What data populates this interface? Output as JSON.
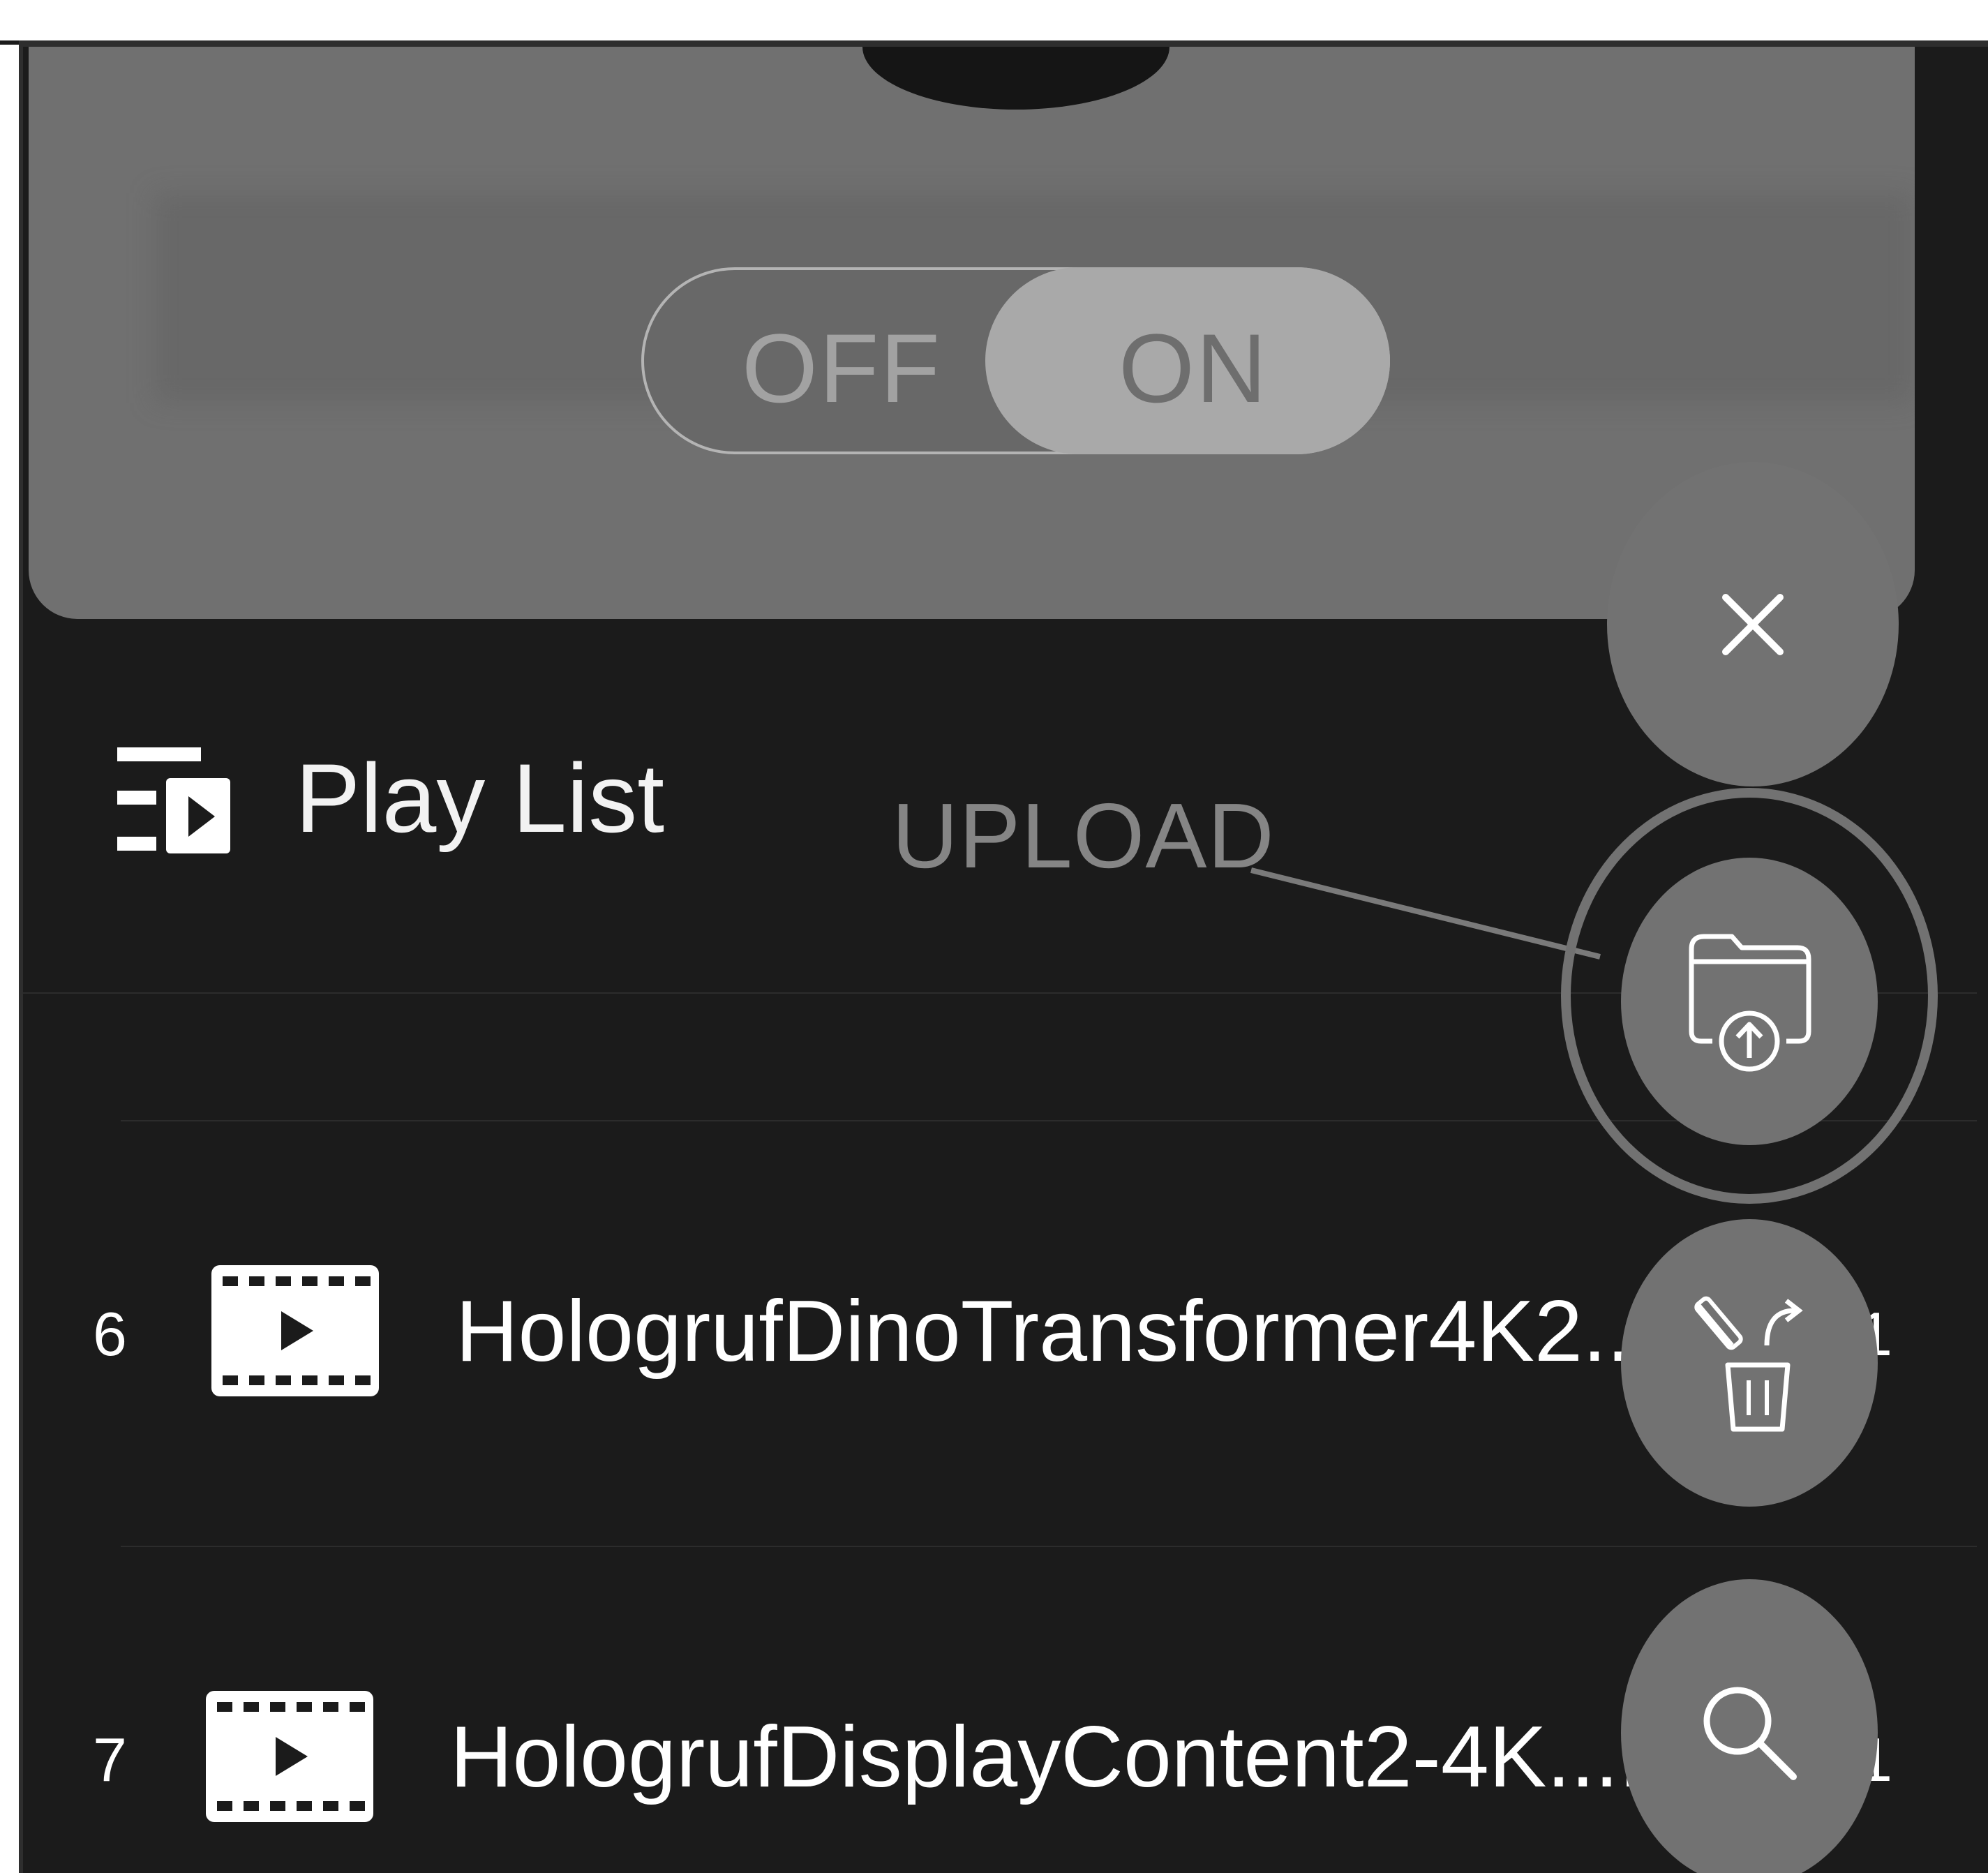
{
  "toggle": {
    "off_label": "OFF",
    "on_label": "ON",
    "state": "on"
  },
  "playlist": {
    "title": "Play List",
    "icon": "playlist-icon"
  },
  "upload": {
    "label": "UPLOAD",
    "icon": "folder-upload-icon"
  },
  "actions": {
    "close_icon": "close-icon",
    "delete_icon": "delete-restore-icon",
    "search_icon": "search-icon"
  },
  "items": [
    {
      "index": "6",
      "name": "HologrufDinoTransformer4K2...",
      "extra": "1",
      "icon": "video-file-icon"
    },
    {
      "index": "7",
      "name": "HologrufDisplayContent2-4K....",
      "extra": "1",
      "icon": "video-file-icon"
    }
  ],
  "colors": {
    "background": "#1b1b1b",
    "card": "#707070",
    "fab": "#727272",
    "text": "#ffffff"
  }
}
